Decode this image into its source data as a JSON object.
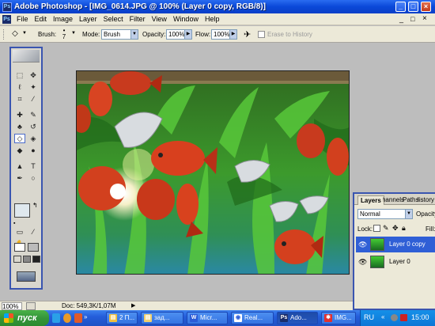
{
  "window": {
    "app_icon_label": "Ps",
    "title": "Adobe Photoshop - [IMG_0614.JPG @ 100% (Layer 0 copy, RGB/8)]",
    "controls": [
      "_",
      "□",
      "×"
    ]
  },
  "menu": {
    "items": [
      "File",
      "Edit",
      "Image",
      "Layer",
      "Select",
      "Filter",
      "View",
      "Window",
      "Help"
    ],
    "window_controls": [
      "_",
      "□",
      "×"
    ]
  },
  "options": {
    "brush_label": "Brush:",
    "brush_size": "7",
    "mode_label": "Mode:",
    "mode_value": "Brush",
    "opacity_label": "Opacity:",
    "opacity_value": "100%",
    "flow_label": "Flow:",
    "flow_value": "100%",
    "erase_history_label": "Erase to History"
  },
  "toolbox": {
    "tools": [
      {
        "name": "marquee-tool",
        "glyph": "⬚"
      },
      {
        "name": "move-tool",
        "glyph": "✥"
      },
      {
        "name": "lasso-tool",
        "glyph": "ℓ"
      },
      {
        "name": "magic-wand-tool",
        "glyph": "✦"
      },
      {
        "name": "crop-tool",
        "glyph": "⌗"
      },
      {
        "name": "slice-tool",
        "glyph": "⁄"
      },
      {
        "name": "healing-brush-tool",
        "glyph": "✚"
      },
      {
        "name": "brush-tool",
        "glyph": "✎"
      },
      {
        "name": "clone-stamp-tool",
        "glyph": "♣"
      },
      {
        "name": "history-brush-tool",
        "glyph": "↺"
      },
      {
        "name": "eraser-tool",
        "glyph": "◇"
      },
      {
        "name": "paint-bucket-tool",
        "glyph": "◈"
      },
      {
        "name": "blur-tool",
        "glyph": "◆"
      },
      {
        "name": "dodge-tool",
        "glyph": "●"
      },
      {
        "name": "path-selection-tool",
        "glyph": "▲"
      },
      {
        "name": "type-tool",
        "glyph": "T"
      },
      {
        "name": "pen-tool",
        "glyph": "✒"
      },
      {
        "name": "shape-tool",
        "glyph": "○"
      },
      {
        "name": "notes-tool",
        "glyph": "▭"
      },
      {
        "name": "eyedropper-tool",
        "glyph": "⁄"
      },
      {
        "name": "hand-tool",
        "glyph": "✋"
      },
      {
        "name": "zoom-tool",
        "glyph": "⌕"
      }
    ],
    "active_tool": "eraser-tool",
    "foreground_color": "#dfe8ee",
    "background_color": "#ffffff"
  },
  "document": {
    "name": "IMG_0614.JPG"
  },
  "status": {
    "zoom": "100%",
    "doc_info": "Doc: 549,3K/1,07M",
    "arrow": "▶"
  },
  "layers_panel": {
    "tabs": [
      "Layers",
      "Channels",
      "Paths",
      "History"
    ],
    "blend_mode": "Normal",
    "opacity_label": "Opacity:",
    "lock_label": "Lock:",
    "fill_label": "Fill:",
    "layers": [
      {
        "name": "Layer 0 copy",
        "selected": true
      },
      {
        "name": "Layer 0",
        "selected": false
      }
    ]
  },
  "taskbar": {
    "start_label": "пуск",
    "buttons": [
      {
        "label": "2 П...",
        "icon_color": "#f0c040",
        "icon_glyph": "▤"
      },
      {
        "label": "зад...",
        "icon_color": "#f0d070",
        "icon_glyph": "▤"
      },
      {
        "label": "Micr...",
        "icon_color": "#2a5bd7",
        "icon_glyph": "W"
      },
      {
        "label": "Real...",
        "icon_color": "#ffffff",
        "icon_glyph": "◉"
      },
      {
        "label": "Ado...",
        "icon_color": "#1a2c6a",
        "icon_glyph": "Ps"
      },
      {
        "label": "IMG...",
        "icon_color": "#e03030",
        "icon_glyph": "✱"
      }
    ],
    "tray": {
      "language": "RU",
      "clock": "15:00"
    }
  },
  "colors": {
    "titlebar": "#0a48d8",
    "panel_border": "#3a55b0",
    "selected_layer": "#2f5fd6",
    "taskbar": "#245edb",
    "start_button": "#35953a"
  }
}
